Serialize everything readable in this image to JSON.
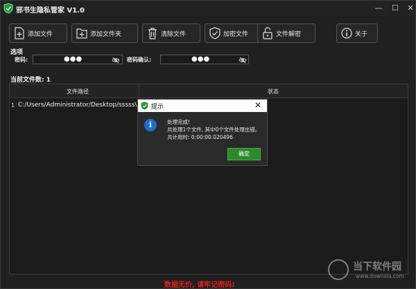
{
  "window": {
    "title": "邪书生隐私管家 V1.0",
    "minimize": "—",
    "maximize": "☐",
    "close": "✕"
  },
  "toolbar": {
    "add_file": "添加文件",
    "add_folder": "添加文件夹",
    "clear_files": "清除文件",
    "encrypt_file": "加密文件",
    "decrypt_file": "文件解密",
    "about": "关于"
  },
  "options": {
    "label": "选项",
    "password_label": "密码:",
    "password_value": "●●●",
    "confirm_label": "密码确认:",
    "confirm_value": "●●●"
  },
  "files": {
    "count_label": "当前文件数: 1",
    "columns": [
      "文件路径",
      "状态"
    ],
    "rows": [
      {
        "index": "1",
        "path": "C:/Users/Administrator/Desktop/sssss\\1.txt",
        "status": ""
      }
    ]
  },
  "dialog": {
    "title": "提示",
    "close": "✕",
    "icon_glyph": "i",
    "line1": "处理完成!",
    "line2": "共处理1个文件, 其中0个文件处理出错。",
    "line3": "共计用时: 0:00:00.020496",
    "ok": "确定"
  },
  "footer": {
    "warning": "数据无价, 请牢记密码!"
  },
  "watermark": {
    "text": "当下软件园",
    "url": "www.downxia.com"
  },
  "colors": {
    "background": "#202020",
    "accent_green": "#2c8a2c",
    "warning_red": "#e0201a",
    "info_blue": "#1a6fd6"
  }
}
